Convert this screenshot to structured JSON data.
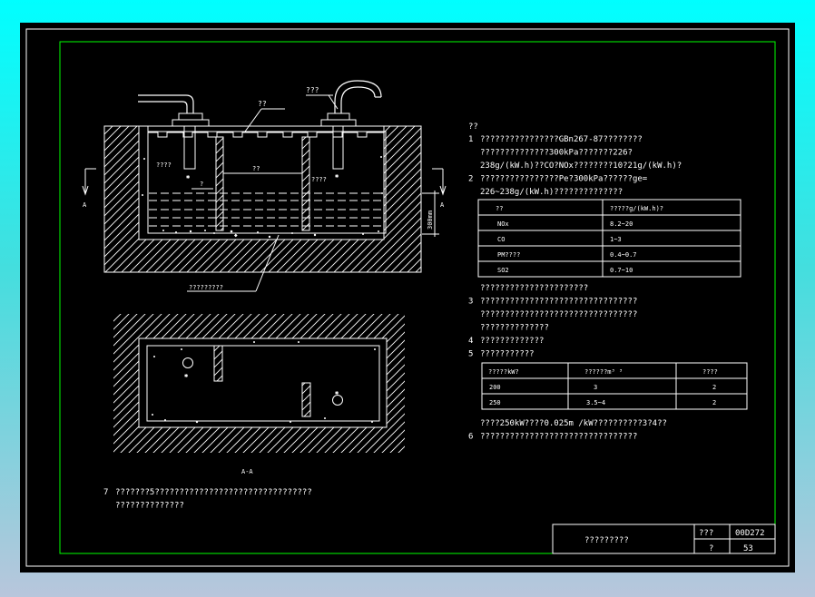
{
  "drawing": {
    "labels": {
      "inlet_pipe": "???",
      "cover_plate": "??",
      "chamber_left": "????",
      "chamber_right": "????",
      "partition_mid": "??",
      "baffle_mark": "?",
      "slab_note": "?????????",
      "depth_label": "300mm",
      "section_mark_left": "A",
      "section_mark_right": "A",
      "section_title": "A-A"
    }
  },
  "notes": {
    "heading": "??",
    "lines": [
      {
        "num": "1",
        "text": "????????????????GBn267-87????????"
      },
      {
        "num": "",
        "text": "??????????????300kPa???????226?"
      },
      {
        "num": "",
        "text": "238g/(kW.h)??CO?NOx????????10?21g/(kW.h)?"
      },
      {
        "num": "2",
        "text": "????????????????Pe?300kPa??????ge="
      },
      {
        "num": "",
        "text": "226~238g/(kW.h)??????????????"
      }
    ],
    "after_table1": [
      {
        "num": "",
        "text": "??????????????????????"
      },
      {
        "num": "3",
        "text": "????????????????????????????????"
      },
      {
        "num": "",
        "text": "????????????????????????????????"
      },
      {
        "num": "",
        "text": "??????????????"
      },
      {
        "num": "4",
        "text": "?????????????"
      },
      {
        "num": "5",
        "text": "???????????"
      }
    ],
    "after_table2": [
      {
        "num": "",
        "text": "????250kW????0.025m  /kW??????????3?4??"
      },
      {
        "num": "6",
        "text": "????????????????????????????????"
      }
    ],
    "note7": [
      {
        "num": "7",
        "text": "???????5????????????????????????????????"
      },
      {
        "num": "",
        "text": "??????????????"
      }
    ]
  },
  "table1": {
    "headers": [
      "??",
      "?????g/(kW.h)?"
    ],
    "rows": [
      [
        "NOx",
        "8.2~20"
      ],
      [
        "CO",
        "1~3"
      ],
      [
        "PM????",
        "0.4~0.7"
      ],
      [
        "SO2",
        "0.7~10"
      ]
    ]
  },
  "table2": {
    "headers": [
      "?????kW?",
      "??????m³  ³",
      "????"
    ],
    "rows": [
      [
        "200",
        "3",
        "2"
      ],
      [
        "250",
        "3.5~4",
        "2"
      ]
    ]
  },
  "title_block": {
    "title": "?????????",
    "label_atlas": "???",
    "atlas_no": "00D272",
    "label_page": "?",
    "page_no": "53"
  },
  "colors": {
    "background_gradient_top": "#00ffff",
    "frame_green": "#00ff00",
    "line_white": "#ffffff"
  }
}
